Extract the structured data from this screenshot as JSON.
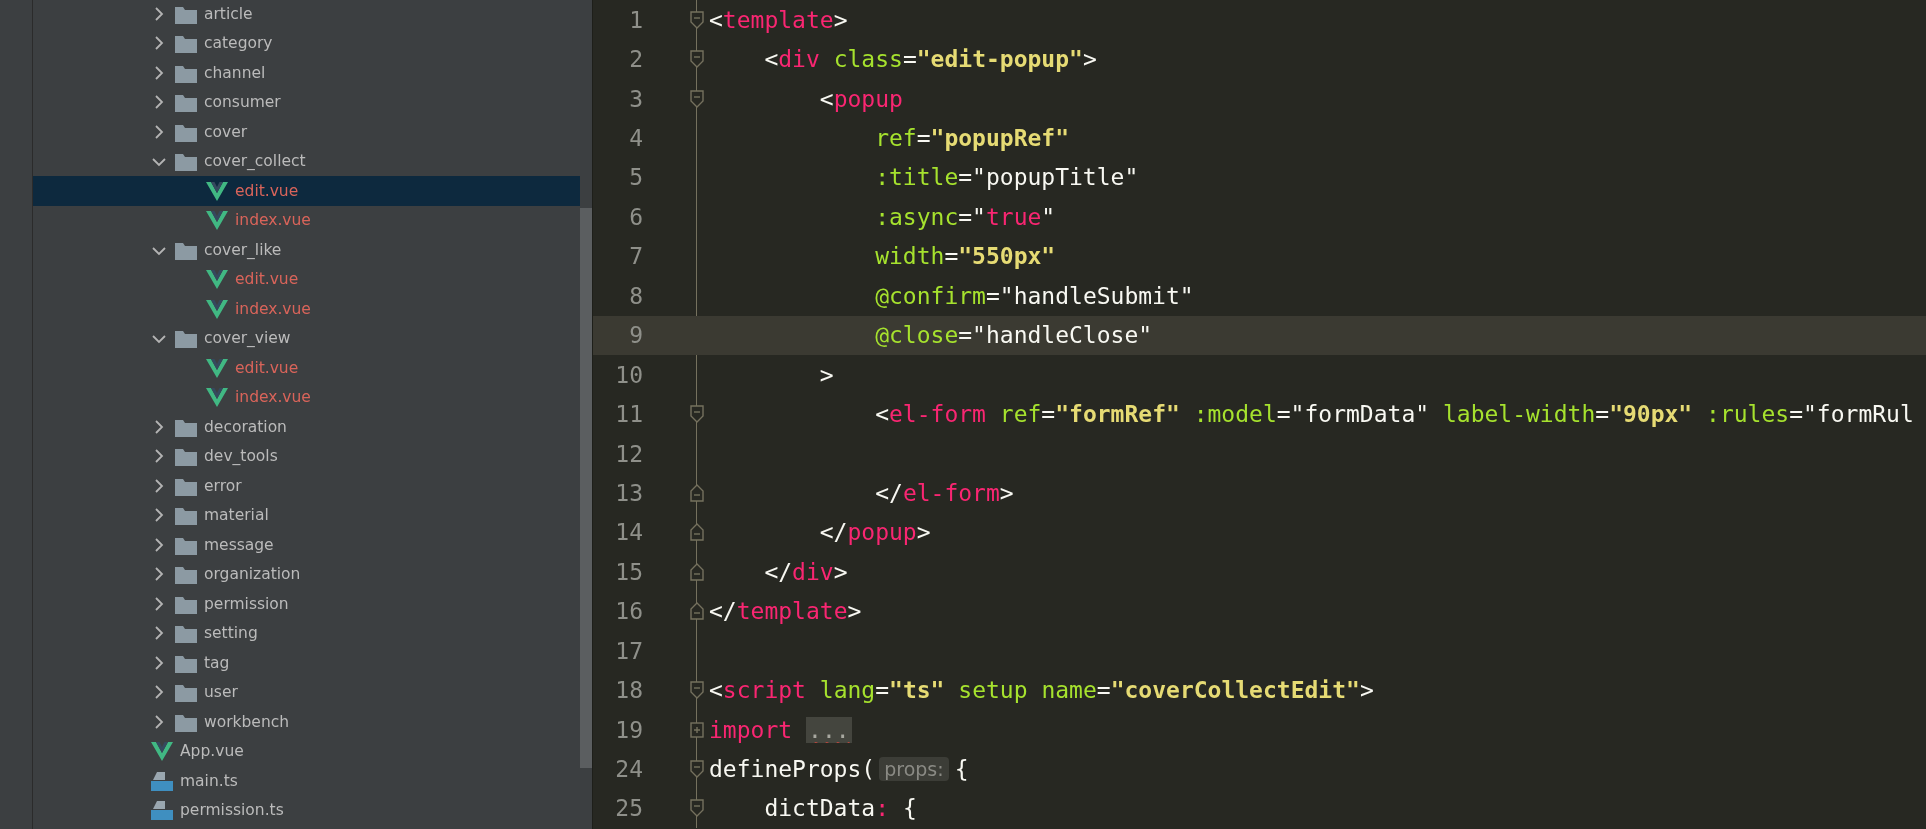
{
  "project_tree": {
    "items": [
      {
        "kind": "folder",
        "label": "article",
        "expanded": false,
        "selected": false,
        "color": "#bbbbbb"
      },
      {
        "kind": "folder",
        "label": "category",
        "expanded": false,
        "selected": false,
        "color": "#bbbbbb"
      },
      {
        "kind": "folder",
        "label": "channel",
        "expanded": false,
        "selected": false,
        "color": "#bbbbbb"
      },
      {
        "kind": "folder",
        "label": "consumer",
        "expanded": false,
        "selected": false,
        "color": "#bbbbbb"
      },
      {
        "kind": "folder",
        "label": "cover",
        "expanded": false,
        "selected": false,
        "color": "#bbbbbb"
      },
      {
        "kind": "folder",
        "label": "cover_collect",
        "expanded": true,
        "selected": false,
        "color": "#bbbbbb",
        "children": [
          {
            "kind": "vue",
            "label": "edit.vue",
            "selected": true,
            "color": "#d9645a"
          },
          {
            "kind": "vue",
            "label": "index.vue",
            "selected": false,
            "color": "#d9645a"
          }
        ]
      },
      {
        "kind": "folder",
        "label": "cover_like",
        "expanded": true,
        "selected": false,
        "color": "#bbbbbb",
        "children": [
          {
            "kind": "vue",
            "label": "edit.vue",
            "selected": false,
            "color": "#d9645a"
          },
          {
            "kind": "vue",
            "label": "index.vue",
            "selected": false,
            "color": "#d9645a"
          }
        ]
      },
      {
        "kind": "folder",
        "label": "cover_view",
        "expanded": true,
        "selected": false,
        "color": "#bbbbbb",
        "children": [
          {
            "kind": "vue",
            "label": "edit.vue",
            "selected": false,
            "color": "#d9645a"
          },
          {
            "kind": "vue",
            "label": "index.vue",
            "selected": false,
            "color": "#d9645a"
          }
        ]
      },
      {
        "kind": "folder",
        "label": "decoration",
        "expanded": false,
        "selected": false,
        "color": "#bbbbbb"
      },
      {
        "kind": "folder",
        "label": "dev_tools",
        "expanded": false,
        "selected": false,
        "color": "#bbbbbb"
      },
      {
        "kind": "folder",
        "label": "error",
        "expanded": false,
        "selected": false,
        "color": "#bbbbbb"
      },
      {
        "kind": "folder",
        "label": "material",
        "expanded": false,
        "selected": false,
        "color": "#bbbbbb"
      },
      {
        "kind": "folder",
        "label": "message",
        "expanded": false,
        "selected": false,
        "color": "#bbbbbb"
      },
      {
        "kind": "folder",
        "label": "organization",
        "expanded": false,
        "selected": false,
        "color": "#bbbbbb"
      },
      {
        "kind": "folder",
        "label": "permission",
        "expanded": false,
        "selected": false,
        "color": "#bbbbbb"
      },
      {
        "kind": "folder",
        "label": "setting",
        "expanded": false,
        "selected": false,
        "color": "#bbbbbb"
      },
      {
        "kind": "folder",
        "label": "tag",
        "expanded": false,
        "selected": false,
        "color": "#bbbbbb"
      },
      {
        "kind": "folder",
        "label": "user",
        "expanded": false,
        "selected": false,
        "color": "#bbbbbb"
      },
      {
        "kind": "folder",
        "label": "workbench",
        "expanded": false,
        "selected": false,
        "color": "#bbbbbb"
      },
      {
        "kind": "vue",
        "label": "App.vue",
        "selected": false,
        "color": "#bbbbbb"
      },
      {
        "kind": "ts",
        "label": "main.ts",
        "selected": false,
        "color": "#bbbbbb"
      },
      {
        "kind": "ts",
        "label": "permission.ts",
        "selected": false,
        "color": "#bbbbbb"
      }
    ]
  },
  "editor": {
    "lines": [
      {
        "number": "1",
        "kind": "start",
        "current": false,
        "tokens": [
          {
            "kind": "punct",
            "text": "<"
          },
          {
            "kind": "tag",
            "text": "template"
          },
          {
            "kind": "punct",
            "text": ">"
          }
        ]
      },
      {
        "number": "2",
        "kind": "start",
        "current": false,
        "tokens": [
          {
            "kind": "punct",
            "text": "    <"
          },
          {
            "kind": "tag",
            "text": "div"
          },
          {
            "kind": "attr",
            "text": " class"
          },
          {
            "kind": "punct",
            "text": "="
          },
          {
            "kind": "string",
            "text": "\"edit-popup\""
          },
          {
            "kind": "punct",
            "text": ">"
          }
        ]
      },
      {
        "number": "3",
        "kind": "start",
        "current": false,
        "tokens": [
          {
            "kind": "punct",
            "text": "        <"
          },
          {
            "kind": "tag",
            "text": "popup"
          }
        ]
      },
      {
        "number": "4",
        "kind": "plain",
        "current": false,
        "tokens": [
          {
            "kind": "attr",
            "text": "            ref"
          },
          {
            "kind": "punct",
            "text": "="
          },
          {
            "kind": "string",
            "text": "\"popupRef\""
          }
        ]
      },
      {
        "number": "5",
        "kind": "plain",
        "current": false,
        "tokens": [
          {
            "kind": "attr",
            "text": "            :title"
          },
          {
            "kind": "punct",
            "text": "=\"popupTitle\""
          }
        ]
      },
      {
        "number": "6",
        "kind": "plain",
        "current": false,
        "tokens": [
          {
            "kind": "attr",
            "text": "            :async"
          },
          {
            "kind": "punct",
            "text": "=\""
          },
          {
            "kind": "tag",
            "text": "true"
          },
          {
            "kind": "punct",
            "text": "\""
          }
        ]
      },
      {
        "number": "7",
        "kind": "plain",
        "current": false,
        "tokens": [
          {
            "kind": "attr",
            "text": "            width"
          },
          {
            "kind": "punct",
            "text": "="
          },
          {
            "kind": "string",
            "text": "\"550px\""
          }
        ]
      },
      {
        "number": "8",
        "kind": "plain",
        "current": false,
        "tokens": [
          {
            "kind": "attr",
            "text": "            @confirm"
          },
          {
            "kind": "punct",
            "text": "=\"handleSubmit\""
          }
        ]
      },
      {
        "number": "9",
        "kind": "plain",
        "current": true,
        "tokens": [
          {
            "kind": "attr",
            "text": "            @close"
          },
          {
            "kind": "punct",
            "text": "=\"handleClose\""
          }
        ]
      },
      {
        "number": "10",
        "kind": "plain",
        "current": false,
        "tokens": [
          {
            "kind": "punct",
            "text": "        >"
          }
        ]
      },
      {
        "number": "11",
        "kind": "start",
        "current": false,
        "tokens": [
          {
            "kind": "punct",
            "text": "            <"
          },
          {
            "kind": "tag",
            "text": "el-form"
          },
          {
            "kind": "attr",
            "text": " ref"
          },
          {
            "kind": "punct",
            "text": "="
          },
          {
            "kind": "string",
            "text": "\"formRef\""
          },
          {
            "kind": "attr",
            "text": " :model"
          },
          {
            "kind": "punct",
            "text": "=\"formData\""
          },
          {
            "kind": "attr",
            "text": " label-width"
          },
          {
            "kind": "punct",
            "text": "="
          },
          {
            "kind": "string",
            "text": "\"90px\""
          },
          {
            "kind": "attr",
            "text": " :rules"
          },
          {
            "kind": "punct",
            "text": "=\"formRul"
          }
        ]
      },
      {
        "number": "12",
        "kind": "plain",
        "current": false
      },
      {
        "number": "13",
        "kind": "end",
        "current": false,
        "tokens": [
          {
            "kind": "punct",
            "text": "            </"
          },
          {
            "kind": "tag",
            "text": "el-form"
          },
          {
            "kind": "punct",
            "text": ">"
          }
        ]
      },
      {
        "number": "14",
        "kind": "end",
        "current": false,
        "tokens": [
          {
            "kind": "punct",
            "text": "        </"
          },
          {
            "kind": "tag",
            "text": "popup"
          },
          {
            "kind": "punct",
            "text": ">"
          }
        ]
      },
      {
        "number": "15",
        "kind": "end",
        "current": false,
        "tokens": [
          {
            "kind": "punct",
            "text": "    </"
          },
          {
            "kind": "tag",
            "text": "div"
          },
          {
            "kind": "punct",
            "text": ">"
          }
        ]
      },
      {
        "number": "16",
        "kind": "end",
        "current": false,
        "tokens": [
          {
            "kind": "punct",
            "text": "</"
          },
          {
            "kind": "tag",
            "text": "template"
          },
          {
            "kind": "punct",
            "text": ">"
          }
        ]
      },
      {
        "number": "17",
        "kind": "plain",
        "current": false
      },
      {
        "number": "18",
        "kind": "start",
        "current": false,
        "tokens": [
          {
            "kind": "punct",
            "text": "<"
          },
          {
            "kind": "tag",
            "text": "script"
          },
          {
            "kind": "attr",
            "text": " lang"
          },
          {
            "kind": "punct",
            "text": "="
          },
          {
            "kind": "string",
            "text": "\"ts\""
          },
          {
            "kind": "attr",
            "text": " setup name"
          },
          {
            "kind": "punct",
            "text": "="
          },
          {
            "kind": "string",
            "text": "\"coverCollectEdit\""
          },
          {
            "kind": "punct",
            "text": ">"
          }
        ]
      },
      {
        "number": "19",
        "kind": "collapsed",
        "current": false,
        "tokens": [
          {
            "kind": "tag",
            "text": "import"
          },
          {
            "kind": "folded",
            "text": "..."
          }
        ]
      },
      {
        "number": "24",
        "kind": "start",
        "current": false,
        "tokens": [
          {
            "kind": "punct",
            "text": "defineProps("
          },
          {
            "kind": "hint",
            "text": "props:"
          },
          {
            "kind": "punct",
            "text": "{"
          }
        ]
      },
      {
        "number": "25",
        "kind": "start",
        "current": false,
        "tokens": [
          {
            "kind": "punct",
            "text": "    dictData"
          },
          {
            "kind": "tag",
            "text": ":"
          },
          {
            "kind": "punct",
            "text": " {"
          }
        ]
      }
    ]
  }
}
